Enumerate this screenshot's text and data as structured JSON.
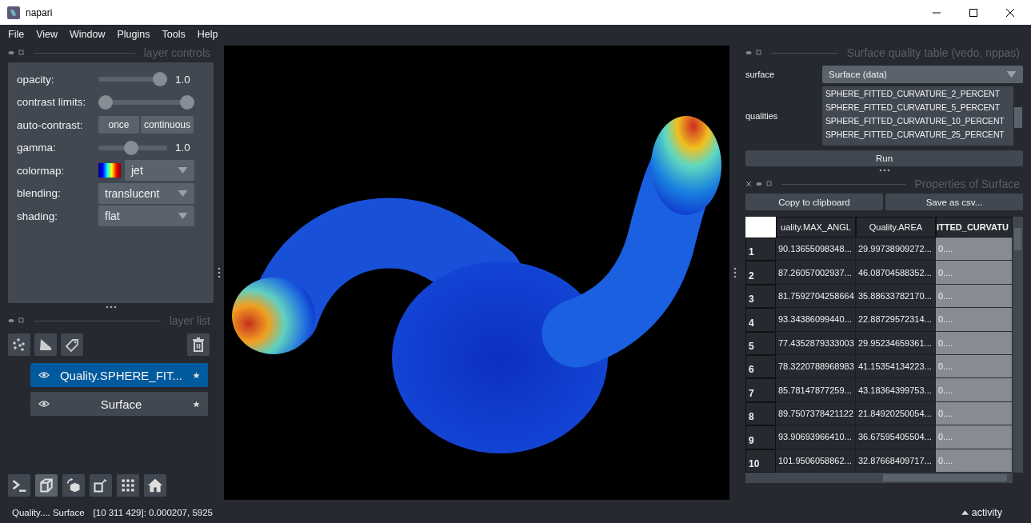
{
  "window": {
    "title": "napari"
  },
  "menu": [
    "File",
    "View",
    "Window",
    "Plugins",
    "Tools",
    "Help"
  ],
  "layer_controls": {
    "title": "layer controls",
    "opacity": {
      "label": "opacity:",
      "level": 1.0,
      "reading": "1.0"
    },
    "contrast_limits": {
      "label": "contrast limits:",
      "low": {
        "level": 0.0
      },
      "high": {
        "level": 1.0
      }
    },
    "auto_contrast": {
      "label": "auto-contrast:",
      "buttons": [
        "once",
        "continuous"
      ]
    },
    "gamma": {
      "label": "gamma:",
      "level": 0.47,
      "reading": "1.0"
    },
    "colormap": {
      "label": "colormap:",
      "value": "jet"
    },
    "blending": {
      "label": "blending:",
      "value": "translucent"
    },
    "shading": {
      "label": "shading:",
      "value": "flat"
    }
  },
  "layer_list": {
    "title": "layer list",
    "layers": [
      {
        "name": "Quality.SPHERE_FIT...",
        "selected": true
      },
      {
        "name": "Surface",
        "selected": false
      }
    ]
  },
  "viewer_buttons": [
    {
      "kind": "console",
      "selected": false
    },
    {
      "kind": "ndisplay",
      "selected": true
    },
    {
      "kind": "roll",
      "selected": false
    },
    {
      "kind": "transpose",
      "selected": false
    },
    {
      "kind": "grid",
      "selected": false
    },
    {
      "kind": "home",
      "selected": false
    }
  ],
  "quality_widget": {
    "title": "Surface quality table (vedo, nppas)",
    "surface_label": "surface",
    "surface_value": "Surface (data)",
    "qualities_label": "qualities",
    "qualities": [
      "SPHERE_FITTED_CURVATURE_2_PERCENT",
      "SPHERE_FITTED_CURVATURE_5_PERCENT",
      "SPHERE_FITTED_CURVATURE_10_PERCENT",
      "SPHERE_FITTED_CURVATURE_25_PERCENT"
    ],
    "run_button": "Run"
  },
  "properties": {
    "title": "Properties of Surface",
    "buttons": [
      "Copy to clipboard",
      "Save as csv..."
    ],
    "columns": [
      {
        "label": "uality.MAX_ANGL",
        "selected": false
      },
      {
        "label": "Quality.AREA",
        "selected": false
      },
      {
        "label": "ITTED_CURVATU",
        "selected": true
      }
    ],
    "rows": [
      {
        "index": "1",
        "cells": [
          "90.13655098348...",
          "29.99738909272...",
          "0...."
        ]
      },
      {
        "index": "2",
        "cells": [
          "87.26057002937...",
          "46.08704588352...",
          "0...."
        ]
      },
      {
        "index": "3",
        "cells": [
          "81.7592704258664",
          "35.88633782170...",
          "0...."
        ]
      },
      {
        "index": "4",
        "cells": [
          "93.34386099440...",
          "22.88729572314...",
          "0...."
        ]
      },
      {
        "index": "5",
        "cells": [
          "77.4352879333003",
          "29.95234659361...",
          "0...."
        ]
      },
      {
        "index": "6",
        "cells": [
          "78.3220788968983",
          "41.15354134223...",
          "0...."
        ]
      },
      {
        "index": "7",
        "cells": [
          "85.78147877259...",
          "43.18364399753...",
          "0...."
        ]
      },
      {
        "index": "8",
        "cells": [
          "89.7507378421122",
          "21.84920250054...",
          "0...."
        ]
      },
      {
        "index": "9",
        "cells": [
          "93.90693966410...",
          "36.67595405504...",
          "0...."
        ]
      },
      {
        "index": "10",
        "cells": [
          "101.9506058862...",
          "32.87668409717...",
          "0...."
        ]
      }
    ]
  },
  "status_bar": {
    "layer": "Quality.... Surface",
    "position": "[10 311 429]: 0.000207, 5925",
    "activity": "activity"
  }
}
